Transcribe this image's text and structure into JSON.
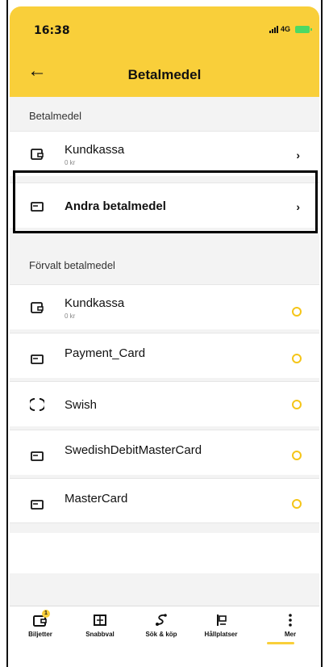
{
  "status": {
    "time": "16:38",
    "network": "4G"
  },
  "header": {
    "title": "Betalmedel"
  },
  "section1": {
    "label": "Betalmedel",
    "items": [
      {
        "label": "Kundkassa",
        "sub": "0 kr"
      },
      {
        "label": "Andra betalmedel"
      }
    ]
  },
  "section2": {
    "label": "Förvalt betalmedel",
    "items": [
      {
        "label": "Kundkassa",
        "sub": "0 kr"
      },
      {
        "label": "Payment_Card"
      },
      {
        "label": "Swish"
      },
      {
        "label": "SwedishDebitMasterCard"
      },
      {
        "label": "MasterCard"
      }
    ]
  },
  "tabs": [
    {
      "label": "Biljetter",
      "badge": "1",
      "icon": "ticket-icon"
    },
    {
      "label": "Snabbval",
      "icon": "quick-icon"
    },
    {
      "label": "Sök & köp",
      "icon": "route-icon"
    },
    {
      "label": "Hållplatser",
      "icon": "stop-icon"
    },
    {
      "label": "Mer",
      "icon": "more-icon"
    }
  ],
  "colors": {
    "accent": "#f9cf3a",
    "radio": "#f5c518"
  }
}
